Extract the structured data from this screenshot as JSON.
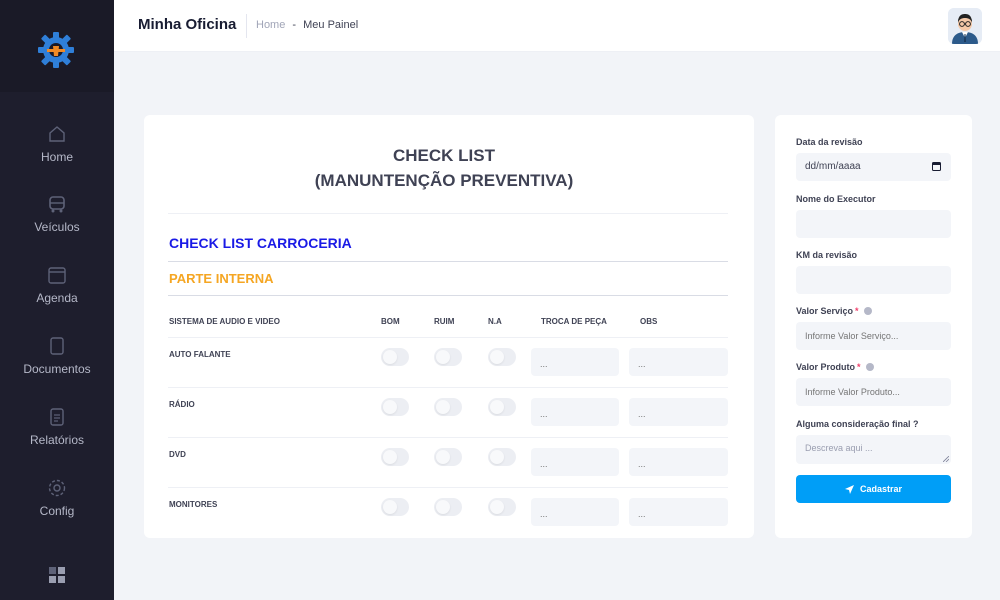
{
  "colors": {
    "sidebar_bg": "#1e1e2d",
    "accent_blue": "#1a1ae6",
    "accent_orange": "#f5a623",
    "primary_button": "#009ef7",
    "required": "#f1416c"
  },
  "sidebar": {
    "logo_icon": "gear-cog-logo-icon",
    "items": [
      {
        "label": "Home",
        "icon": "home-icon"
      },
      {
        "label": "Veículos",
        "icon": "bus-icon"
      },
      {
        "label": "Agenda",
        "icon": "calendar-icon"
      },
      {
        "label": "Documentos",
        "icon": "document-icon"
      },
      {
        "label": "Relatórios",
        "icon": "report-icon"
      },
      {
        "label": "Config",
        "icon": "gear-icon"
      }
    ],
    "bottom_icon": "grid-menu-icon"
  },
  "header": {
    "title": "Minha Oficina",
    "breadcrumb": {
      "home": "Home",
      "separator": "-",
      "current": "Meu Painel"
    },
    "avatar": "user-avatar"
  },
  "checklist": {
    "title_line1": "CHECK LIST",
    "title_line2": "(MANUNTENÇÃO PREVENTIVA)",
    "section_title": "CHECK LIST CARROCERIA",
    "subsection_title": "PARTE INTERNA",
    "columns": {
      "item": "SISTEMA DE AUDIO E VIDEO",
      "bom": "BOM",
      "ruim": "RUIM",
      "na": "N.A",
      "troca": "TROCA DE PEÇA",
      "obs": "OBS"
    },
    "input_placeholder": "...",
    "rows": [
      {
        "label": "AUTO FALANTE"
      },
      {
        "label": "RÁDIO"
      },
      {
        "label": "DVD"
      },
      {
        "label": "MONITORES"
      }
    ]
  },
  "form": {
    "date_label": "Data da revisão",
    "date_value": "dd/mm/aaaa",
    "executor_label": "Nome do Executor",
    "executor_value": "",
    "km_label": "KM da revisão",
    "km_value": "",
    "service_label": "Valor Serviço",
    "service_placeholder": "Informe Valor Serviço...",
    "product_label": "Valor Produto",
    "product_placeholder": "Informe Valor Produto...",
    "final_label": "Alguma consideração final ?",
    "final_placeholder": "Descreva aqui ...",
    "required_mark": "*",
    "submit_label": "Cadastrar"
  }
}
